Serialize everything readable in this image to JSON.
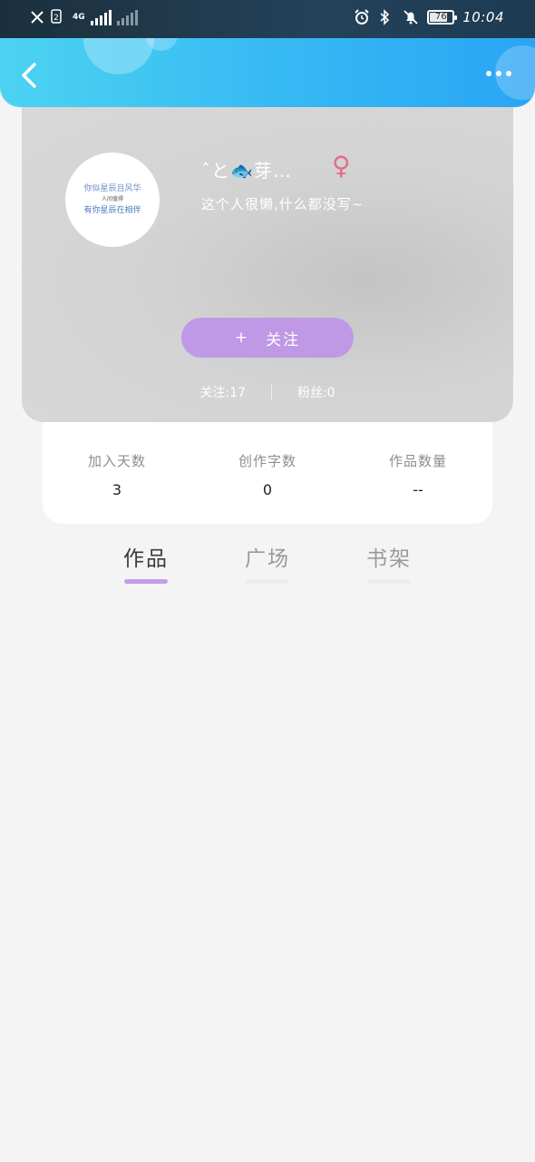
{
  "status_bar": {
    "network_left": "4G",
    "battery_level": "76",
    "time": "10:04"
  },
  "header": {
    "back_icon": "chevron-left-icon",
    "more_icon": "more-dots-icon"
  },
  "profile": {
    "username": "ˆと🐟芽…",
    "gender_symbol": "♀",
    "bio": "这个人很懒,什么都没写~",
    "avatar_text": [
      "你似星辰且风华",
      "有你星辰在相伴",
      "人间值得"
    ],
    "follow_button": {
      "plus": "+",
      "label": "关注"
    },
    "following": "关注:17",
    "fans": "粉丝:0"
  },
  "stats": [
    {
      "label": "加入天数",
      "value": "3"
    },
    {
      "label": "创作字数",
      "value": "0"
    },
    {
      "label": "作品数量",
      "value": "--"
    }
  ],
  "tabs": [
    {
      "label": "作品",
      "active": true
    },
    {
      "label": "广场",
      "active": false
    },
    {
      "label": "书架",
      "active": false
    }
  ],
  "colors": {
    "header_start": "#4cd3f2",
    "header_end": "#2aa5f5",
    "follow_button": "#bf99e6",
    "tab_active_indicator": "#c49ee6",
    "gender": "#e76a8a"
  }
}
